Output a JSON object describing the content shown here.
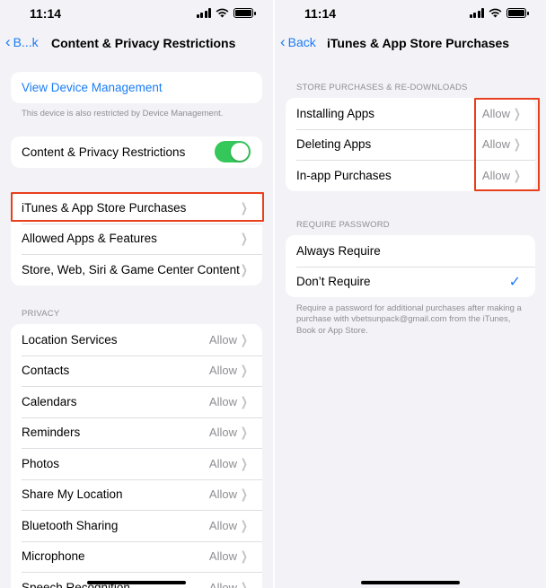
{
  "status_bar": {
    "time": "11:14"
  },
  "left": {
    "nav": {
      "back_label": "B...k",
      "title": "Content & Privacy Restrictions"
    },
    "device_management": {
      "link": "View Device Management",
      "note": "This device is also restricted by Device Management."
    },
    "toggle": {
      "label": "Content & Privacy Restrictions",
      "on": true
    },
    "menu": [
      {
        "label": "iTunes & App Store Purchases"
      },
      {
        "label": "Allowed Apps & Features"
      },
      {
        "label": "Store, Web, Siri & Game Center Content"
      }
    ],
    "privacy_header": "PRIVACY",
    "privacy_items": [
      {
        "label": "Location Services",
        "value": "Allow"
      },
      {
        "label": "Contacts",
        "value": "Allow"
      },
      {
        "label": "Calendars",
        "value": "Allow"
      },
      {
        "label": "Reminders",
        "value": "Allow"
      },
      {
        "label": "Photos",
        "value": "Allow"
      },
      {
        "label": "Share My Location",
        "value": "Allow"
      },
      {
        "label": "Bluetooth Sharing",
        "value": "Allow"
      },
      {
        "label": "Microphone",
        "value": "Allow"
      },
      {
        "label": "Speech Recognition",
        "value": "Allow"
      }
    ]
  },
  "right": {
    "nav": {
      "back_label": "Back",
      "title": "iTunes & App Store Purchases"
    },
    "store_header": "STORE PURCHASES & RE-DOWNLOADS",
    "store_items": [
      {
        "label": "Installing Apps",
        "value": "Allow"
      },
      {
        "label": "Deleting Apps",
        "value": "Allow"
      },
      {
        "label": "In-app Purchases",
        "value": "Allow"
      }
    ],
    "password_header": "REQUIRE PASSWORD",
    "password_options": [
      {
        "label": "Always Require",
        "selected": false
      },
      {
        "label": "Don’t Require",
        "selected": true
      }
    ],
    "footer": "Require a password for additional purchases after making a purchase with vbetsunpack@gmail.com from the iTunes, Book or App Store."
  },
  "colors": {
    "accent": "#1a7cf5",
    "toggle_on": "#34c759",
    "highlight": "#e8401c",
    "background": "#f2f2f7"
  },
  "icons": [
    "chevron-left-icon",
    "chevron-right-icon",
    "checkmark-icon",
    "signal-icon",
    "wifi-icon",
    "battery-icon"
  ]
}
